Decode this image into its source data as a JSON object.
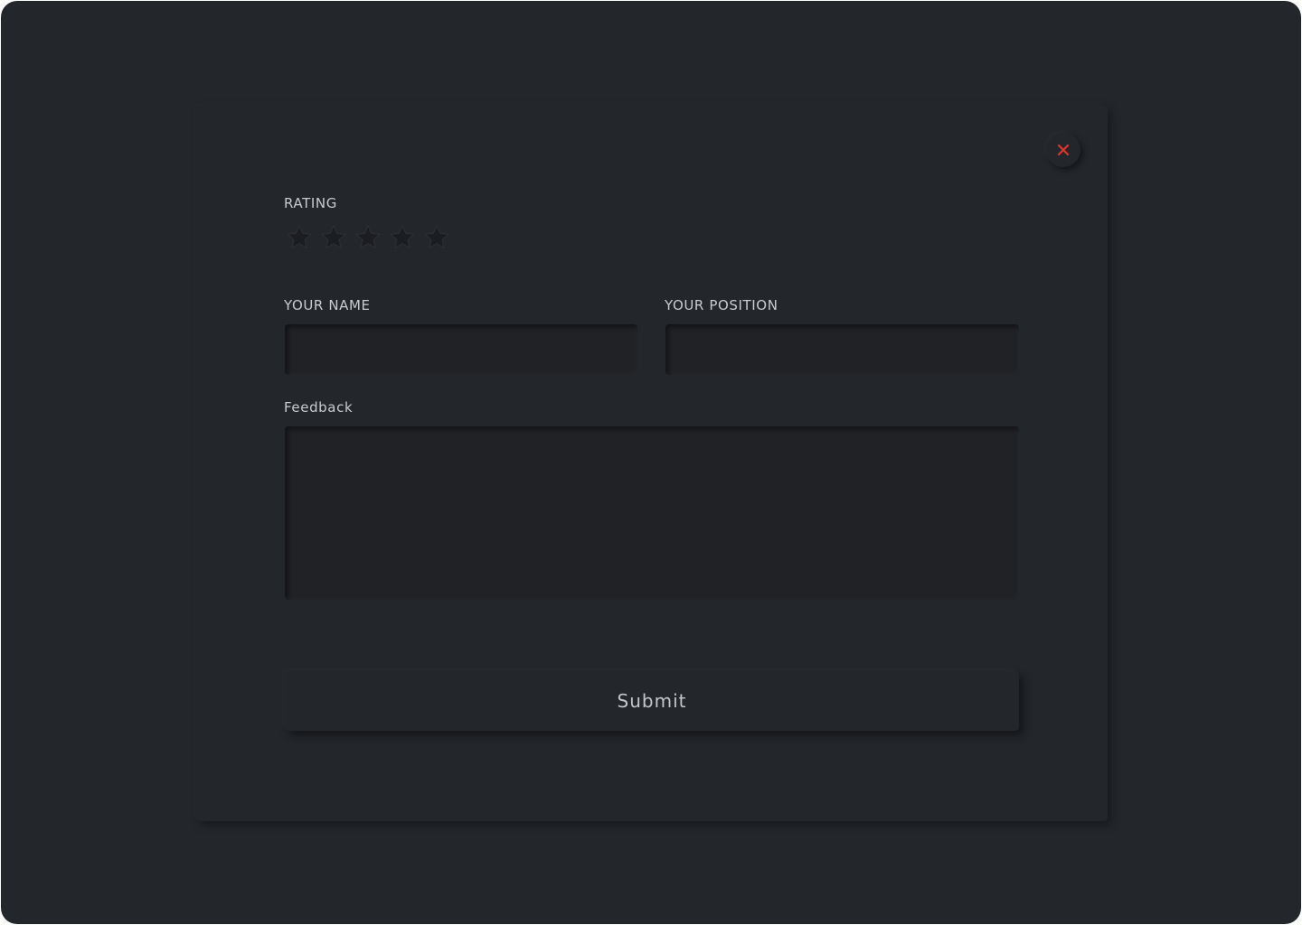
{
  "form": {
    "rating_label": "RATING",
    "rating_value": 0,
    "rating_max": 5,
    "name_label": "YOUR NAME",
    "name_value": "",
    "position_label": "YOUR POSITION",
    "position_value": "",
    "feedback_label": "Feedback",
    "feedback_value": "",
    "submit_label": "Submit"
  },
  "icons": {
    "close": "close-icon",
    "star": "star-icon"
  },
  "colors": {
    "background": "#23262b",
    "close_accent": "#e0352b",
    "text": "#c9cbd0"
  }
}
